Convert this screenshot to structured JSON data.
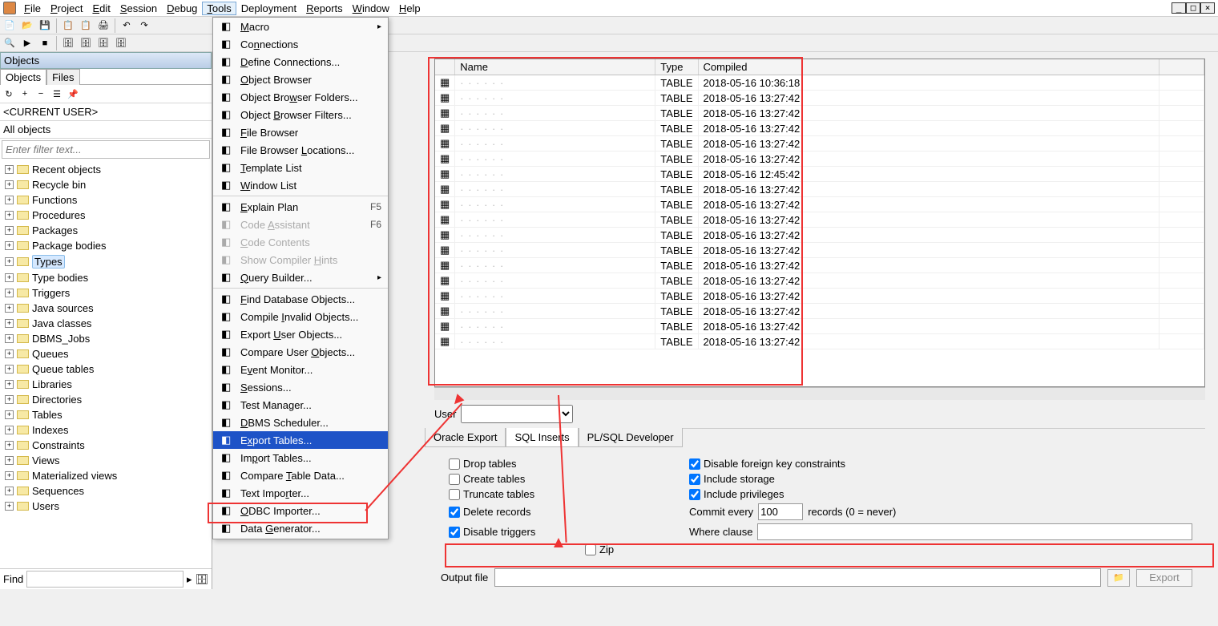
{
  "menubar": {
    "items": [
      {
        "label": "File",
        "u": "F"
      },
      {
        "label": "Project",
        "u": "P"
      },
      {
        "label": "Edit",
        "u": "E"
      },
      {
        "label": "Session",
        "u": "S"
      },
      {
        "label": "Debug",
        "u": "D"
      },
      {
        "label": "Tools",
        "u": "T",
        "active": true
      },
      {
        "label": "Deployment"
      },
      {
        "label": "Reports",
        "u": "R"
      },
      {
        "label": "Window",
        "u": "W"
      },
      {
        "label": "Help",
        "u": "H"
      }
    ]
  },
  "left": {
    "panel_title": "Objects",
    "tabs": {
      "active": "Objects",
      "other": "Files"
    },
    "current_user": "<CURRENT USER>",
    "scope": "All objects",
    "filter_placeholder": "Enter filter text...",
    "tree": [
      "Recent objects",
      "Recycle bin",
      "Functions",
      "Procedures",
      "Packages",
      "Package bodies",
      "Types",
      "Type bodies",
      "Triggers",
      "Java sources",
      "Java classes",
      "DBMS_Jobs",
      "Queues",
      "Queue tables",
      "Libraries",
      "Directories",
      "Tables",
      "Indexes",
      "Constraints",
      "Views",
      "Materialized views",
      "Sequences",
      "Users"
    ],
    "selected": "Types",
    "find_label": "Find"
  },
  "tools_menu": [
    {
      "label": "Macro",
      "u": "M",
      "icon": "arrow-icon",
      "sub": true
    },
    {
      "label": "Connections",
      "u": "n",
      "icon": "gear-icon"
    },
    {
      "label": "Define Connections...",
      "u": "D",
      "icon": "gear-icon"
    },
    {
      "label": "Object Browser",
      "u": "O",
      "icon": "browser-icon"
    },
    {
      "label": "Object Browser Folders...",
      "u": "w",
      "icon": "browser-icon"
    },
    {
      "label": "Object Browser Filters...",
      "u": "B",
      "icon": "filter-icon"
    },
    {
      "label": "File Browser",
      "u": "F",
      "icon": "file-icon"
    },
    {
      "label": "File Browser Locations...",
      "u": "L",
      "icon": "file-icon"
    },
    {
      "label": "Template List",
      "u": "T",
      "icon": "template-icon"
    },
    {
      "label": "Window List",
      "u": "W",
      "icon": "window-icon"
    },
    {
      "sep": true
    },
    {
      "label": "Explain Plan",
      "u": "E",
      "icon": "plan-icon",
      "shortcut": "F5"
    },
    {
      "label": "Code Assistant",
      "u": "A",
      "icon": "assist-icon",
      "shortcut": "F6",
      "dis": true
    },
    {
      "label": "Code Contents",
      "u": "C",
      "icon": "contents-icon",
      "dis": true
    },
    {
      "label": "Show Compiler Hints",
      "u": "H",
      "icon": "hint-icon",
      "dis": true
    },
    {
      "label": "Query Builder...",
      "u": "Q",
      "icon": "query-icon",
      "sub": true
    },
    {
      "sep": true
    },
    {
      "label": "Find Database Objects...",
      "u": "F",
      "icon": "find-icon"
    },
    {
      "label": "Compile Invalid Objects...",
      "u": "I",
      "icon": "compile-icon"
    },
    {
      "label": "Export User Objects...",
      "u": "U",
      "icon": "export-icon"
    },
    {
      "label": "Compare User Objects...",
      "u": "O",
      "icon": "compare-icon"
    },
    {
      "label": "Event Monitor...",
      "u": "v",
      "icon": "monitor-icon"
    },
    {
      "label": "Sessions...",
      "u": "S",
      "icon": "session-icon"
    },
    {
      "label": "Test Manager...",
      "u": "g",
      "icon": "test-icon"
    },
    {
      "label": "DBMS Scheduler...",
      "u": "D",
      "icon": "sched-icon"
    },
    {
      "label": "Export Tables...",
      "u": "x",
      "icon": "export-tables-icon",
      "sel": true
    },
    {
      "label": "Import Tables...",
      "u": "p",
      "icon": "import-icon"
    },
    {
      "label": "Compare Table Data...",
      "u": "T",
      "icon": "compare-data-icon"
    },
    {
      "label": "Text Importer...",
      "u": "r",
      "icon": "text-icon"
    },
    {
      "label": "ODBC Importer...",
      "u": "O",
      "icon": "odbc-icon"
    },
    {
      "label": "Data Generator...",
      "u": "G",
      "icon": "datagen-icon"
    }
  ],
  "table": {
    "headers": [
      "Name",
      "Type",
      "Compiled"
    ],
    "rows": [
      {
        "type": "TABLE",
        "compiled": "2018-05-16 10:36:18"
      },
      {
        "type": "TABLE",
        "compiled": "2018-05-16 13:27:42"
      },
      {
        "type": "TABLE",
        "compiled": "2018-05-16 13:27:42"
      },
      {
        "type": "TABLE",
        "compiled": "2018-05-16 13:27:42"
      },
      {
        "type": "TABLE",
        "compiled": "2018-05-16 13:27:42"
      },
      {
        "type": "TABLE",
        "compiled": "2018-05-16 13:27:42"
      },
      {
        "type": "TABLE",
        "compiled": "2018-05-16 12:45:42"
      },
      {
        "type": "TABLE",
        "compiled": "2018-05-16 13:27:42"
      },
      {
        "type": "TABLE",
        "compiled": "2018-05-16 13:27:42"
      },
      {
        "type": "TABLE",
        "compiled": "2018-05-16 13:27:42"
      },
      {
        "type": "TABLE",
        "compiled": "2018-05-16 13:27:42"
      },
      {
        "type": "TABLE",
        "compiled": "2018-05-16 13:27:42"
      },
      {
        "type": "TABLE",
        "compiled": "2018-05-16 13:27:42"
      },
      {
        "type": "TABLE",
        "compiled": "2018-05-16 13:27:42"
      },
      {
        "type": "TABLE",
        "compiled": "2018-05-16 13:27:42"
      },
      {
        "type": "TABLE",
        "compiled": "2018-05-16 13:27:42"
      },
      {
        "type": "TABLE",
        "compiled": "2018-05-16 13:27:42"
      },
      {
        "type": "TABLE",
        "compiled": "2018-05-16 13:27:42"
      }
    ]
  },
  "user_label": "User",
  "export_tabs": {
    "t1": "Oracle Export",
    "t2": "SQL Inserts",
    "t3": "PL/SQL Developer",
    "active": "SQL Inserts"
  },
  "options": {
    "drop": "Drop tables",
    "create": "Create tables",
    "truncate": "Truncate tables",
    "delete": "Delete records",
    "disable_triggers": "Disable triggers",
    "zip": "Zip",
    "disable_fk": "Disable foreign key constraints",
    "include_storage": "Include storage",
    "include_priv": "Include privileges",
    "commit_every": "Commit every",
    "commit_value": "100",
    "commit_suffix": "records (0 = never)",
    "where": "Where clause",
    "output_file": "Output file",
    "export_btn": "Export"
  }
}
